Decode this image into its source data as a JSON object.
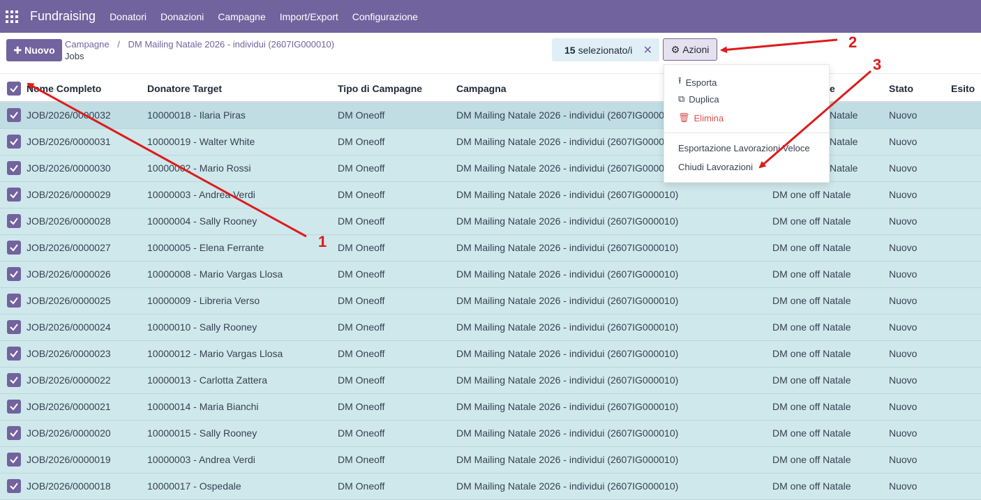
{
  "topbar": {
    "app_title": "Fundraising",
    "nav": [
      "Donatori",
      "Donazioni",
      "Campagne",
      "Import/Export",
      "Configurazione"
    ],
    "background": "#71639e"
  },
  "control": {
    "new_label": "Nuovo",
    "breadcrumb_parent": "Campagne",
    "breadcrumb_current": "DM Mailing Natale 2026 - individui (2607IG000010)",
    "subtitle": "Jobs",
    "selection_count": "15",
    "selection_label": "selezionato/i",
    "actions_label": "Azioni"
  },
  "actions_menu": {
    "export": "Esporta",
    "duplicate": "Duplica",
    "delete": "Elimina",
    "quick_export": "Esportazione Lavorazioni Veloce",
    "close_jobs": "Chiudi Lavorazioni"
  },
  "table": {
    "headers": {
      "name": "Nome Completo",
      "donor": "Donatore Target",
      "type": "Tipo di Campagne",
      "campaign": "Campagna",
      "sub": "e",
      "status": "Stato",
      "outcome": "Esito"
    },
    "rows": [
      {
        "name": "JOB/2026/0000032",
        "donor": "10000018 - Ilaria Piras",
        "type": "DM Oneoff",
        "campaign": "DM Mailing Natale 2026 - individui (2607IG0000",
        "sub": "Natale",
        "status": "Nuovo"
      },
      {
        "name": "JOB/2026/0000031",
        "donor": "10000019 - Walter White",
        "type": "DM Oneoff",
        "campaign": "DM Mailing Natale 2026 - individui (2607IG0000",
        "sub": "Natale",
        "status": "Nuovo"
      },
      {
        "name": "JOB/2026/0000030",
        "donor": "10000002 - Mario Rossi",
        "type": "DM Oneoff",
        "campaign": "DM Mailing Natale 2026 - individui (2607IG0000",
        "sub": "Natale",
        "status": "Nuovo"
      },
      {
        "name": "JOB/2026/0000029",
        "donor": "10000003 - Andrea Verdi",
        "type": "DM Oneoff",
        "campaign": "DM Mailing Natale 2026 - individui (2607IG000010)",
        "sub": "DM one off Natale",
        "status": "Nuovo"
      },
      {
        "name": "JOB/2026/0000028",
        "donor": "10000004 - Sally Rooney",
        "type": "DM Oneoff",
        "campaign": "DM Mailing Natale 2026 - individui (2607IG000010)",
        "sub": "DM one off Natale",
        "status": "Nuovo"
      },
      {
        "name": "JOB/2026/0000027",
        "donor": "10000005 - Elena Ferrante",
        "type": "DM Oneoff",
        "campaign": "DM Mailing Natale 2026 - individui (2607IG000010)",
        "sub": "DM one off Natale",
        "status": "Nuovo"
      },
      {
        "name": "JOB/2026/0000026",
        "donor": "10000008 - Mario Vargas Llosa",
        "type": "DM Oneoff",
        "campaign": "DM Mailing Natale 2026 - individui (2607IG000010)",
        "sub": "DM one off Natale",
        "status": "Nuovo"
      },
      {
        "name": "JOB/2026/0000025",
        "donor": "10000009 - Libreria Verso",
        "type": "DM Oneoff",
        "campaign": "DM Mailing Natale 2026 - individui (2607IG000010)",
        "sub": "DM one off Natale",
        "status": "Nuovo"
      },
      {
        "name": "JOB/2026/0000024",
        "donor": "10000010 - Sally Rooney",
        "type": "DM Oneoff",
        "campaign": "DM Mailing Natale 2026 - individui (2607IG000010)",
        "sub": "DM one off Natale",
        "status": "Nuovo"
      },
      {
        "name": "JOB/2026/0000023",
        "donor": "10000012 - Mario Vargas Llosa",
        "type": "DM Oneoff",
        "campaign": "DM Mailing Natale 2026 - individui (2607IG000010)",
        "sub": "DM one off Natale",
        "status": "Nuovo"
      },
      {
        "name": "JOB/2026/0000022",
        "donor": "10000013 - Carlotta Zattera",
        "type": "DM Oneoff",
        "campaign": "DM Mailing Natale 2026 - individui (2607IG000010)",
        "sub": "DM one off Natale",
        "status": "Nuovo"
      },
      {
        "name": "JOB/2026/0000021",
        "donor": "10000014 - Maria Bianchi",
        "type": "DM Oneoff",
        "campaign": "DM Mailing Natale 2026 - individui (2607IG000010)",
        "sub": "DM one off Natale",
        "status": "Nuovo"
      },
      {
        "name": "JOB/2026/0000020",
        "donor": "10000015 - Sally Rooney",
        "type": "DM Oneoff",
        "campaign": "DM Mailing Natale 2026 - individui (2607IG000010)",
        "sub": "DM one off Natale",
        "status": "Nuovo"
      },
      {
        "name": "JOB/2026/0000019",
        "donor": "10000003 - Andrea Verdi",
        "type": "DM Oneoff",
        "campaign": "DM Mailing Natale 2026 - individui (2607IG000010)",
        "sub": "DM one off Natale",
        "status": "Nuovo"
      },
      {
        "name": "JOB/2026/0000018",
        "donor": "10000017 - Ospedale",
        "type": "DM Oneoff",
        "campaign": "DM Mailing Natale 2026 - individui (2607IG000010)",
        "sub": "DM one off Natale",
        "status": "Nuovo"
      }
    ]
  },
  "annotations": [
    "1",
    "2",
    "3"
  ],
  "colors": {
    "accent": "#71639e",
    "row_selected": "#cfe8ec",
    "annotation": "#dc1c1c",
    "danger": "#d9534f"
  }
}
